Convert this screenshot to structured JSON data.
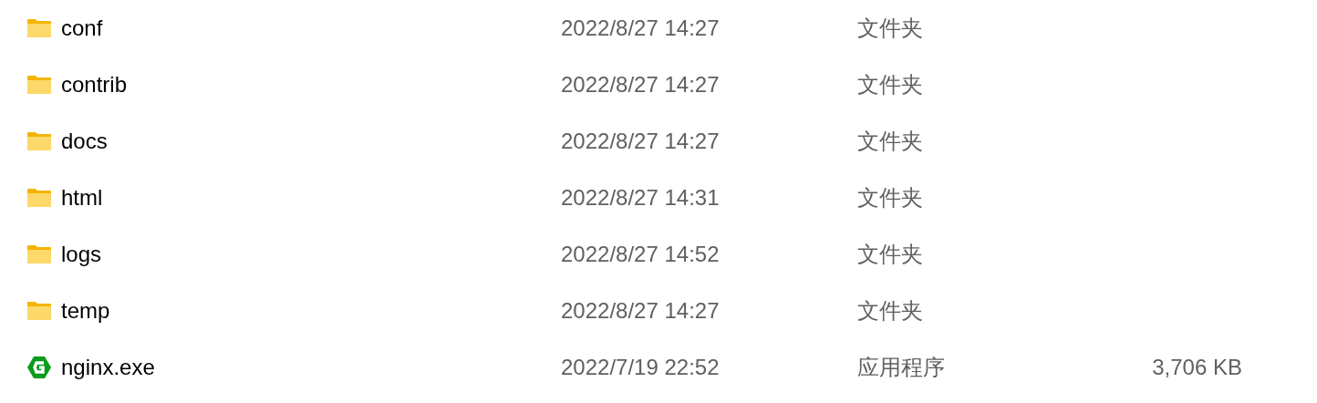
{
  "files": [
    {
      "kind": "folder",
      "name": "conf",
      "modified": "2022/8/27 14:27",
      "type": "文件夹"
    },
    {
      "kind": "folder",
      "name": "contrib",
      "modified": "2022/8/27 14:27",
      "type": "文件夹"
    },
    {
      "kind": "folder",
      "name": "docs",
      "modified": "2022/8/27 14:27",
      "type": "文件夹"
    },
    {
      "kind": "folder",
      "name": "html",
      "modified": "2022/8/27 14:31",
      "type": "文件夹"
    },
    {
      "kind": "folder",
      "name": "logs",
      "modified": "2022/8/27 14:52",
      "type": "文件夹"
    },
    {
      "kind": "folder",
      "name": "temp",
      "modified": "2022/8/27 14:27",
      "type": "文件夹"
    },
    {
      "kind": "application",
      "name": "nginx.exe",
      "modified": "2022/7/19 22:52",
      "type": "应用程序",
      "size": "3,706 KB"
    }
  ]
}
